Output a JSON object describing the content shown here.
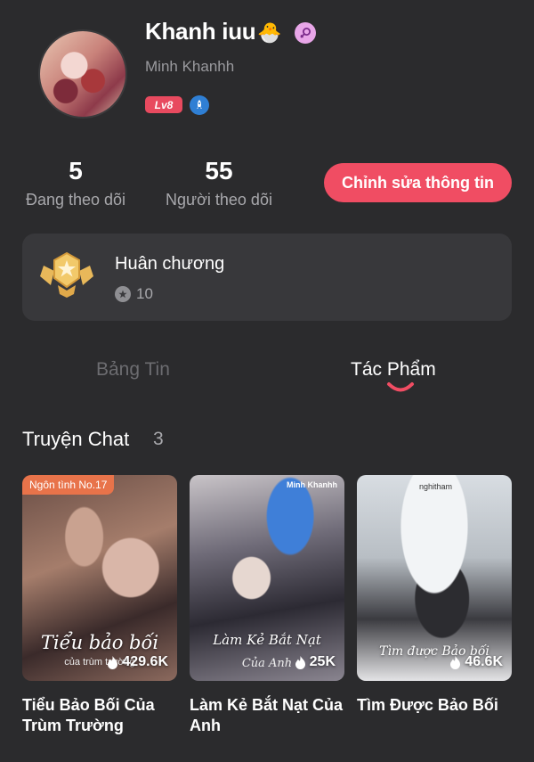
{
  "profile": {
    "display_name": "Khanh iuu",
    "name_emoji": "🐣",
    "gender": "female",
    "username": "Minh Khanhh",
    "level": "Lv8"
  },
  "stats": {
    "following_count": "5",
    "following_label": "Đang theo dõi",
    "followers_count": "55",
    "followers_label": "Người theo dõi"
  },
  "edit_button": "Chỉnh sửa thông tin",
  "medals": {
    "title": "Huân chương",
    "count": "10"
  },
  "tabs": [
    {
      "label": "Bảng Tin",
      "active": false
    },
    {
      "label": "Tác Phẩm",
      "active": true
    }
  ],
  "section": {
    "title": "Truyện Chat",
    "count": "3"
  },
  "stories": [
    {
      "title": "Tiểu Bảo Bối Của Trùm Trường",
      "rank_tag": "Ngôn tình No.17",
      "cover_text": "Tiểu bảo bối",
      "cover_sub": "của trùm trường",
      "views": "429.6K"
    },
    {
      "title": "Làm Kẻ Bắt Nạt Của Anh",
      "cover_watermark": "Minh Khanhh",
      "cover_text": "Làm Kẻ Bắt Nạt",
      "cover_sub": "Của Anh",
      "views": "25K"
    },
    {
      "title": "Tìm Được Bảo Bối",
      "cover_watermark": "nghitham",
      "cover_text": "Tìm được Bảo bối",
      "views": "46.6K"
    }
  ],
  "colors": {
    "background": "#2b2b2d",
    "accent": "#f04d63",
    "card": "#38383b",
    "muted_text": "#a8a8ac"
  }
}
